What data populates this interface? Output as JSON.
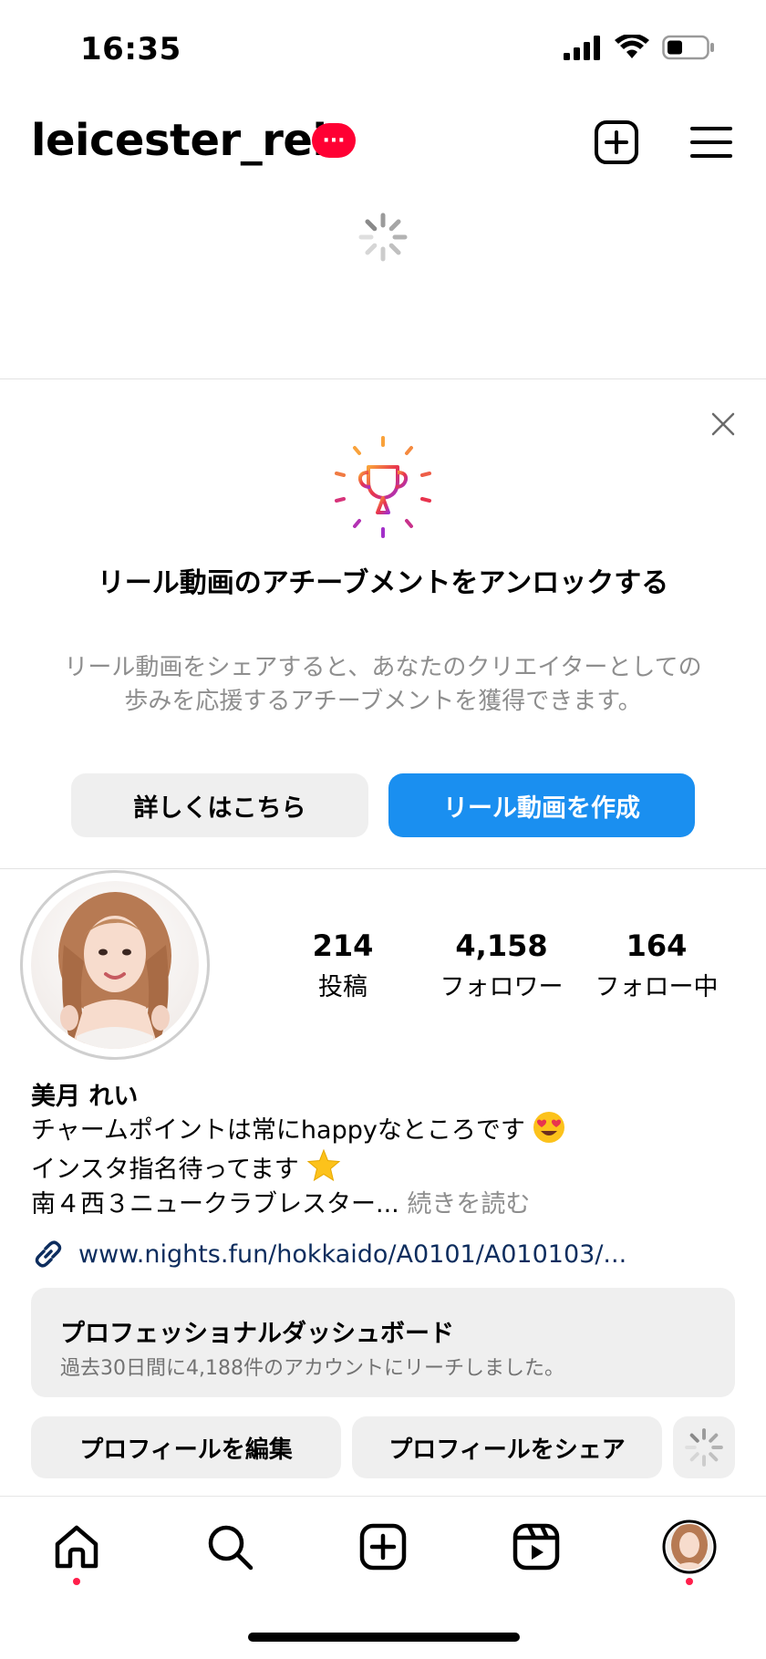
{
  "status_bar": {
    "time": "16:35",
    "battery_level": 0.4
  },
  "header": {
    "username": "leicester_rei",
    "badge": "···"
  },
  "achievement": {
    "title": "リール動画のアチーブメントをアンロックする",
    "description": "リール動画をシェアすると、あなたのクリエイターとしての歩みを応援するアチーブメントを獲得できます。",
    "learn_more_label": "詳しくはこちら",
    "create_reel_label": "リール動画を作成"
  },
  "profile": {
    "stats": [
      {
        "value": "214",
        "label": "投稿"
      },
      {
        "value": "4,158",
        "label": "フォロワー"
      },
      {
        "value": "164",
        "label": "フォロー中"
      }
    ],
    "display_name": "美月 れい",
    "bio_line1": "チャームポイントは常にhappyなところです",
    "bio_line2": "インスタ指名待ってます",
    "bio_line3": "南４西３ニュークラブレスター...",
    "more_label": "続きを読む",
    "link": "www.nights.fun/hokkaido/A0101/A010103/..."
  },
  "dashboard": {
    "title": "プロフェッショナルダッシュボード",
    "subtitle": "過去30日間に4,188件のアカウントにリーチしました。"
  },
  "actions": {
    "edit_label": "プロフィールを編集",
    "share_label": "プロフィールをシェア"
  },
  "tabs": [
    "home-icon",
    "search-icon",
    "create-icon",
    "reels-icon",
    "profile-avatar"
  ],
  "colors": {
    "accent": "#1a8ff0",
    "badge": "#ff0033",
    "notify": "#ff1f4b"
  }
}
